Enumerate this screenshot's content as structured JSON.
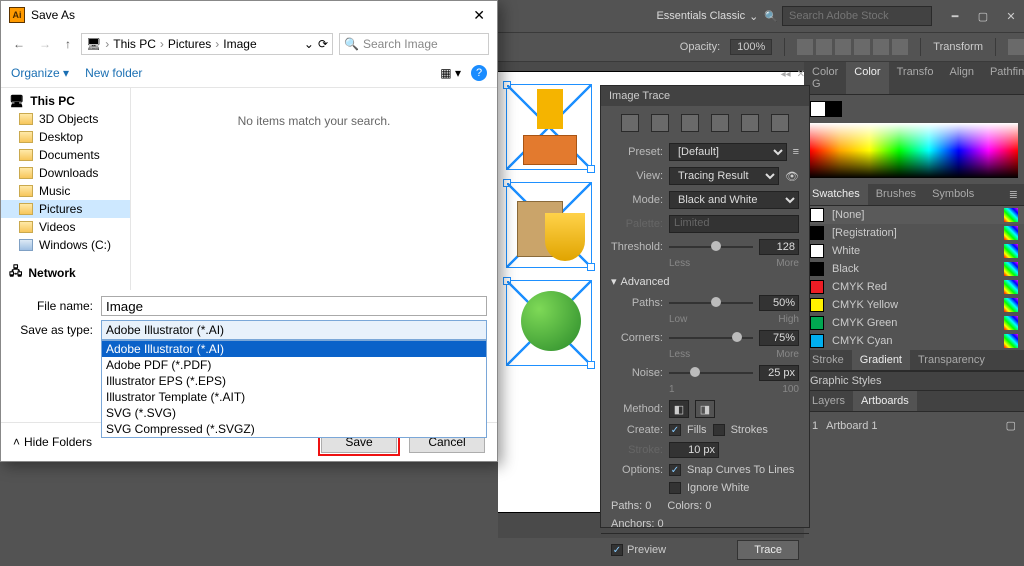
{
  "app": {
    "workspace": "Essentials Classic",
    "search_placeholder": "Search Adobe Stock"
  },
  "controlbar": {
    "opacity_label": "Opacity:",
    "opacity_value": "100%",
    "transform_label": "Transform"
  },
  "canvas": {},
  "trace": {
    "title": "Image Trace",
    "preset_label": "Preset:",
    "preset_value": "[Default]",
    "view_label": "View:",
    "view_value": "Tracing Result",
    "mode_label": "Mode:",
    "mode_value": "Black and White",
    "palette_label": "Palette:",
    "palette_value": "Limited",
    "threshold_label": "Threshold:",
    "threshold_value": "128",
    "threshold_low": "Less",
    "threshold_high": "More",
    "advanced_label": "Advanced",
    "paths_label": "Paths:",
    "paths_value": "50%",
    "paths_low": "Low",
    "paths_high": "High",
    "corners_label": "Corners:",
    "corners_value": "75%",
    "corners_low": "Less",
    "corners_high": "More",
    "noise_label": "Noise:",
    "noise_value": "25 px",
    "noise_low": "1",
    "noise_high": "100",
    "method_label": "Method:",
    "create_label": "Create:",
    "create_fills": "Fills",
    "create_strokes": "Strokes",
    "stroke_label": "Stroke:",
    "stroke_value": "10 px",
    "options_label": "Options:",
    "opt_snap": "Snap Curves To Lines",
    "opt_ignore": "Ignore White",
    "info_paths_label": "Paths:",
    "info_paths_value": "0",
    "info_colors_label": "Colors:",
    "info_colors_value": "0",
    "info_anchors_label": "Anchors:",
    "info_anchors_value": "0",
    "preview_label": "Preview",
    "trace_btn": "Trace"
  },
  "right": {
    "color_tabs": [
      "Color G",
      "Color",
      "Transfo",
      "Align",
      "Pathfin"
    ],
    "swatch_tabs": [
      "Swatches",
      "Brushes",
      "Symbols"
    ],
    "swatches": [
      {
        "name": "[None]",
        "color": "#fff"
      },
      {
        "name": "[Registration]",
        "color": "#000"
      },
      {
        "name": "White",
        "color": "#fff"
      },
      {
        "name": "Black",
        "color": "#000"
      },
      {
        "name": "CMYK Red",
        "color": "#ed1c24"
      },
      {
        "name": "CMYK Yellow",
        "color": "#fff200"
      },
      {
        "name": "CMYK Green",
        "color": "#00a651"
      },
      {
        "name": "CMYK Cyan",
        "color": "#00aeef"
      }
    ],
    "grad_tabs": [
      "Stroke",
      "Gradient",
      "Transparency"
    ],
    "styles_title": "Graphic Styles",
    "layer_tabs": [
      "Layers",
      "Artboards"
    ],
    "artboard_index": "1",
    "artboard_name": "Artboard 1"
  },
  "dialog": {
    "title": "Save As",
    "path": [
      "This PC",
      "Pictures",
      "Image"
    ],
    "search_placeholder": "Search Image",
    "organize": "Organize",
    "newfolder": "New folder",
    "empty_msg": "No items match your search.",
    "tree_header": "This PC",
    "tree_network": "Network",
    "tree": [
      {
        "label": "3D Objects",
        "ic": "folder-ic"
      },
      {
        "label": "Desktop",
        "ic": "folder-ic"
      },
      {
        "label": "Documents",
        "ic": "folder-ic"
      },
      {
        "label": "Downloads",
        "ic": "folder-ic"
      },
      {
        "label": "Music",
        "ic": "folder-ic"
      },
      {
        "label": "Pictures",
        "ic": "folder-ic",
        "sel": true
      },
      {
        "label": "Videos",
        "ic": "folder-ic"
      },
      {
        "label": "Windows (C:)",
        "ic": "drive-ic"
      }
    ],
    "filename_label": "File name:",
    "filename_value": "Image",
    "saveas_label": "Save as type:",
    "saveas_value": "Adobe Illustrator (*.AI)",
    "formats": [
      "Adobe Illustrator (*.AI)",
      "Adobe PDF (*.PDF)",
      "Illustrator EPS (*.EPS)",
      "Illustrator Template (*.AIT)",
      "SVG (*.SVG)",
      "SVG Compressed (*.SVGZ)"
    ],
    "hide_folders": "Hide Folders",
    "save_btn": "Save",
    "cancel_btn": "Cancel"
  }
}
